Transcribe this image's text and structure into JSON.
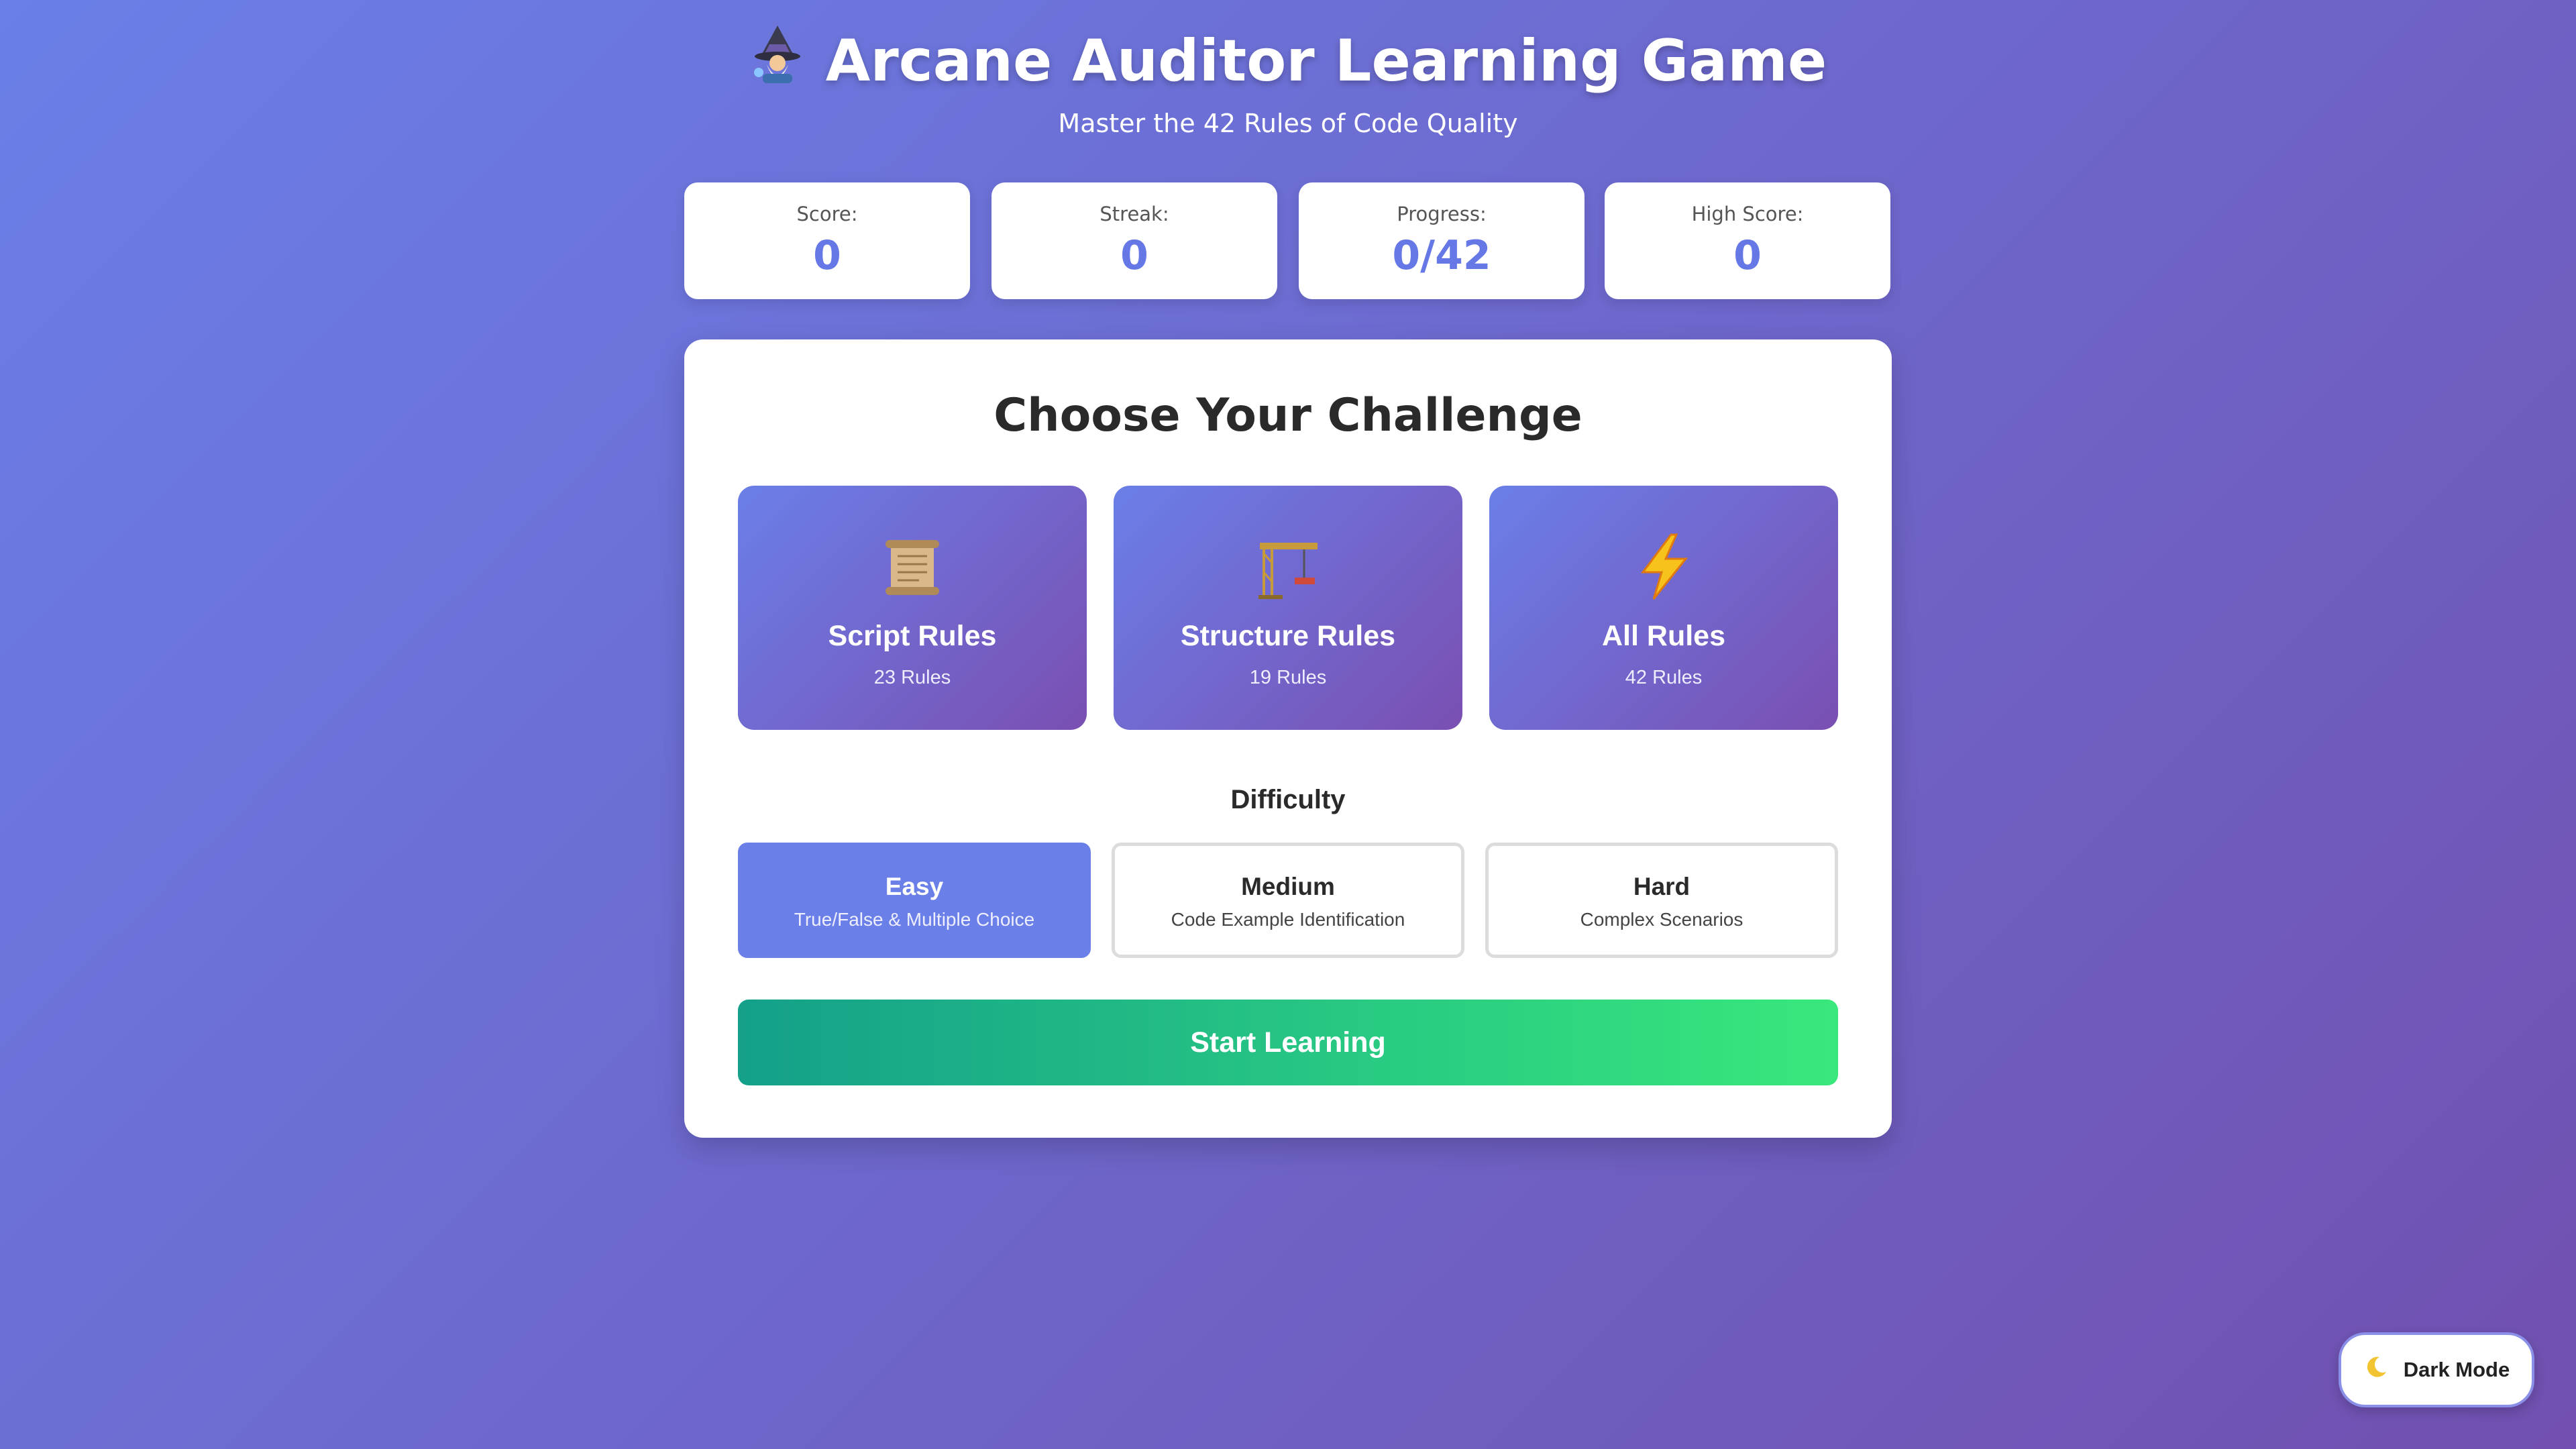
{
  "header": {
    "title": "Arcane Auditor Learning Game",
    "title_icon": "wizard-icon",
    "subtitle": "Master the 42 Rules of Code Quality"
  },
  "stats": [
    {
      "label": "Score:",
      "value": "0"
    },
    {
      "label": "Streak:",
      "value": "0"
    },
    {
      "label": "Progress:",
      "value": "0/42"
    },
    {
      "label": "High Score:",
      "value": "0"
    }
  ],
  "challenge": {
    "title": "Choose Your Challenge",
    "categories": [
      {
        "icon": "scroll-icon",
        "name": "Script Rules",
        "count": "23 Rules"
      },
      {
        "icon": "crane-icon",
        "name": "Structure Rules",
        "count": "19 Rules"
      },
      {
        "icon": "lightning-icon",
        "name": "All Rules",
        "count": "42 Rules"
      }
    ],
    "difficulty_title": "Difficulty",
    "difficulties": [
      {
        "name": "Easy",
        "desc": "True/False & Multiple Choice",
        "selected": true
      },
      {
        "name": "Medium",
        "desc": "Code Example Identification",
        "selected": false
      },
      {
        "name": "Hard",
        "desc": "Complex Scenarios",
        "selected": false
      }
    ],
    "start_label": "Start Learning"
  },
  "dark_mode": {
    "label": "Dark Mode",
    "icon": "moon-icon"
  },
  "colors": {
    "accent": "#6a7fe8",
    "background_start": "#6a7fe8",
    "background_end": "#7150b0",
    "start_start": "#14a08a",
    "start_end": "#38e87c"
  }
}
